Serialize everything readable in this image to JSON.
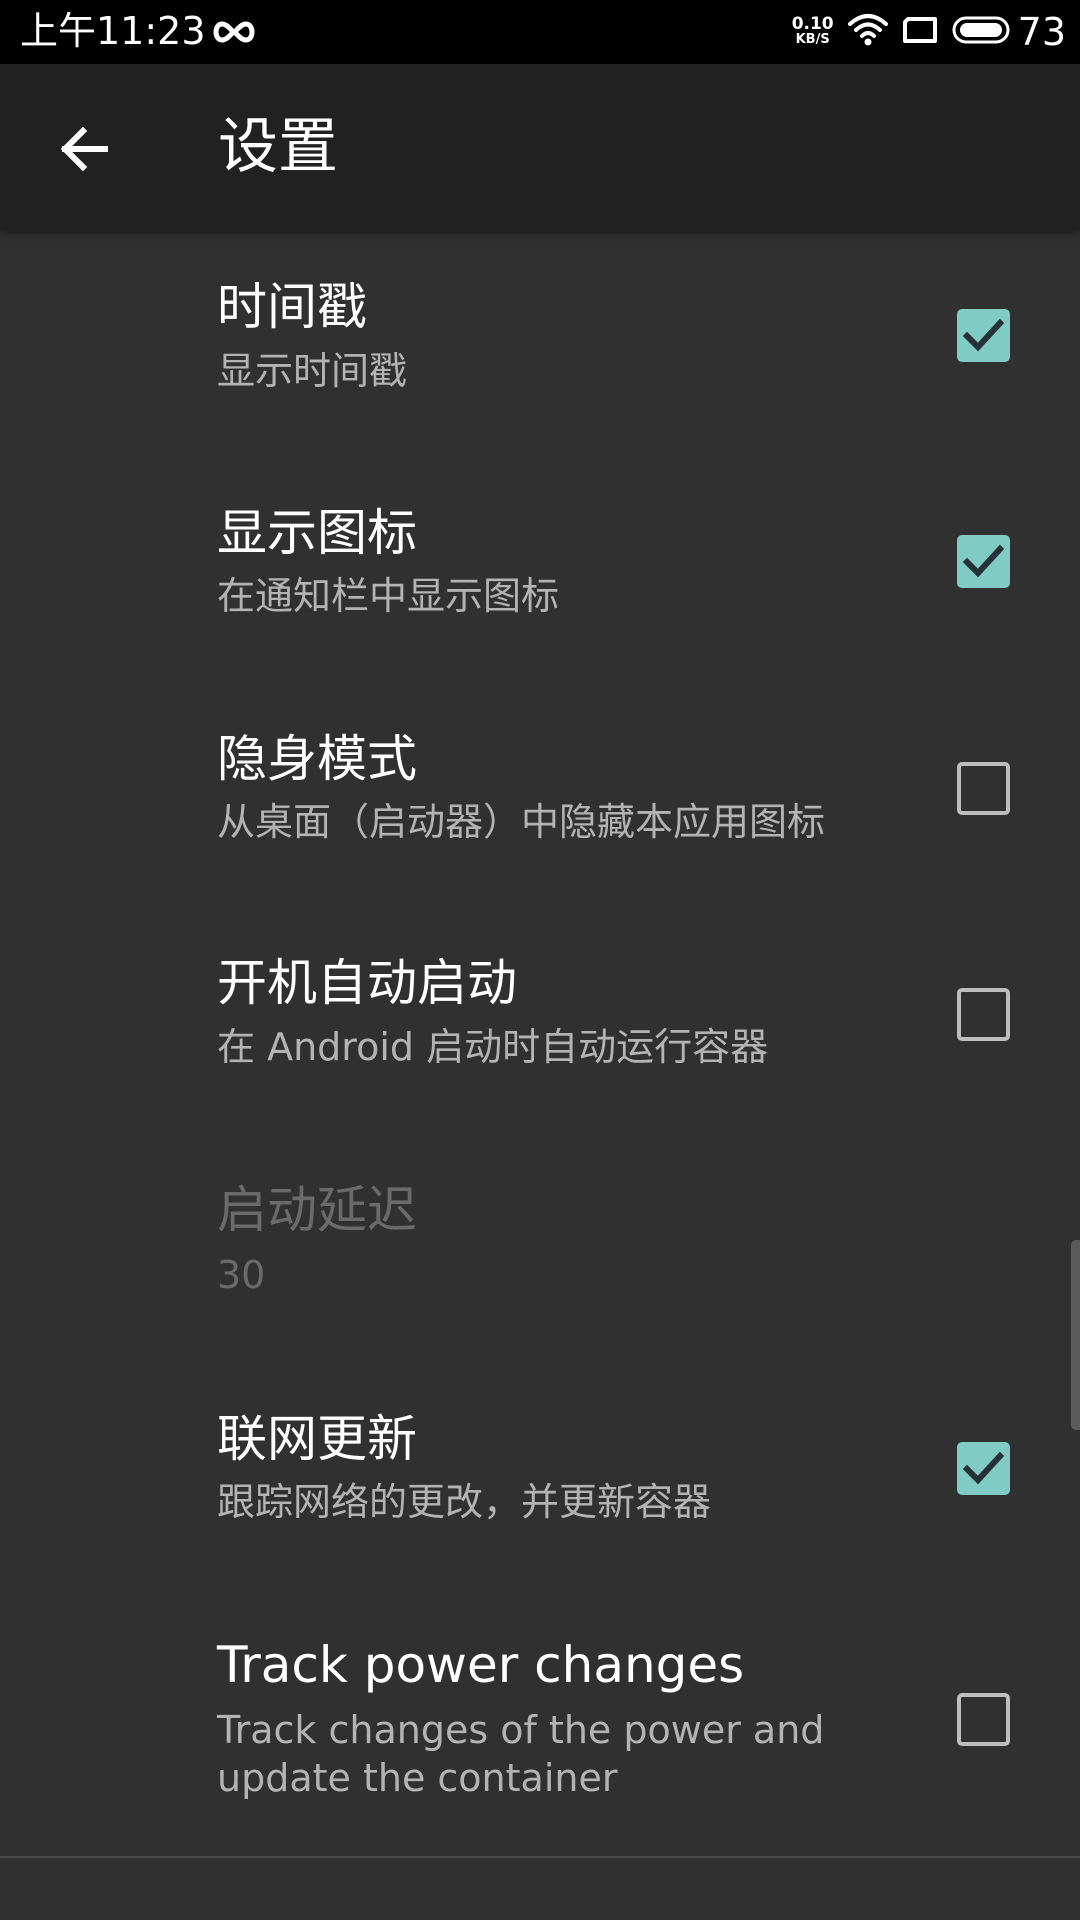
{
  "status_bar": {
    "time": "上午11:23",
    "net_speed_value": "0.10",
    "net_speed_unit": "KB/S",
    "battery": "73",
    "icons": [
      "infinity-link-icon",
      "wifi-icon",
      "tablet-icon",
      "battery-icon"
    ]
  },
  "app_bar": {
    "title": "设置",
    "back_icon": "arrow-left-icon"
  },
  "settings": [
    {
      "title": "时间戳",
      "summary": "显示时间戳",
      "checked": true,
      "enabled": true
    },
    {
      "title": "显示图标",
      "summary": "在通知栏中显示图标",
      "checked": true,
      "enabled": true
    },
    {
      "title": "隐身模式",
      "summary": "从桌面（启动器）中隐藏本应用图标",
      "checked": false,
      "enabled": true
    },
    {
      "title": "开机自动启动",
      "summary": "在 Android 启动时自动运行容器",
      "checked": false,
      "enabled": true
    },
    {
      "title": "启动延迟",
      "summary": "30",
      "enabled": false
    },
    {
      "title": "联网更新",
      "summary": "跟踪网络的更改，并更新容器",
      "checked": true,
      "enabled": true
    },
    {
      "title": "Track power changes",
      "summary_line1": "Track changes of the power and",
      "summary_line2": "update the container",
      "checked": false,
      "enabled": true
    }
  ],
  "colors": {
    "background": "#303030",
    "app_bar": "#212121",
    "status_bar": "#000000",
    "accent": "#80cbc4",
    "summary_text": "#b3b3b3",
    "disabled_text": "#6a6a6a"
  }
}
